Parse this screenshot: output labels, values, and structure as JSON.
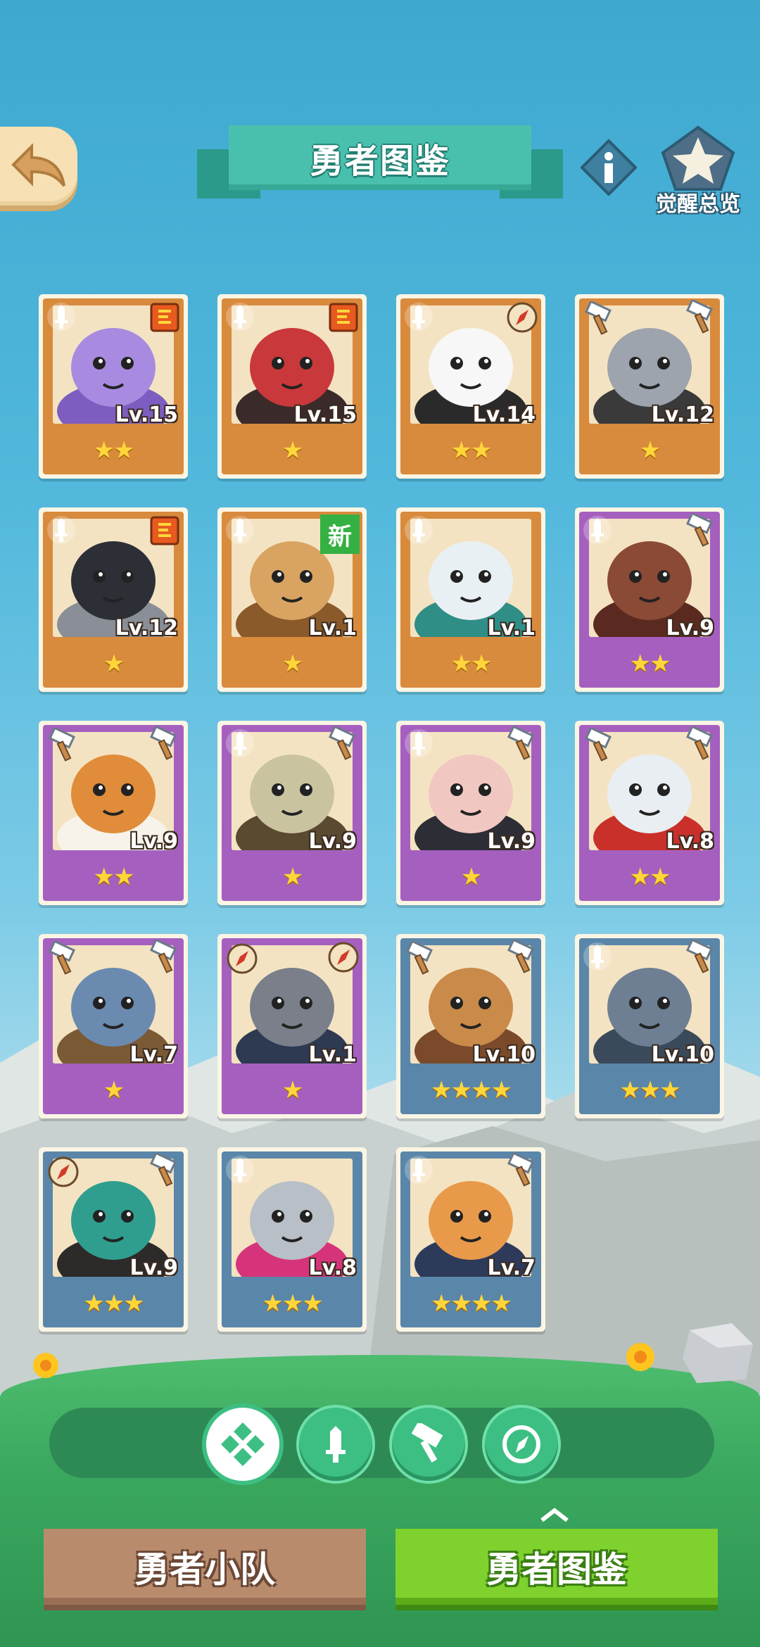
{
  "header": {
    "title": "勇者图鉴",
    "awaken_label": "觉醒总览"
  },
  "colors": {
    "orange_card": "#d88a3d",
    "purple_card": "#a560bf",
    "blue_card": "#5a86a9",
    "star": "#ffd63a",
    "new_badge": "#35b042"
  },
  "heroes": [
    {
      "level": "Lv.15",
      "stars": "★★",
      "rarity": "orange",
      "class_icon": "sword-icon",
      "weapon_icon": "scroll-icon",
      "portrait": "purple-elephant"
    },
    {
      "level": "Lv.15",
      "stars": "★",
      "rarity": "orange",
      "class_icon": "sword-icon",
      "weapon_icon": "scroll-icon",
      "portrait": "red-bird"
    },
    {
      "level": "Lv.14",
      "stars": "★★",
      "rarity": "orange",
      "class_icon": "sword-icon",
      "weapon_icon": "compass-icon",
      "portrait": "white-seal"
    },
    {
      "level": "Lv.12",
      "stars": "★",
      "rarity": "orange",
      "class_icon": "hammer-icon",
      "weapon_icon": "hammer-icon",
      "portrait": "gray-gorilla"
    },
    {
      "level": "Lv.12",
      "stars": "★",
      "rarity": "orange",
      "class_icon": "sword-icon",
      "weapon_icon": "scroll-icon",
      "portrait": "black-goat"
    },
    {
      "level": "Lv.1",
      "stars": "★",
      "rarity": "orange",
      "class_icon": "sword-icon",
      "badge": "新",
      "portrait": "lynx"
    },
    {
      "level": "Lv.1",
      "stars": "★★",
      "rarity": "orange",
      "class_icon": "sword-icon",
      "weapon_icon": "",
      "portrait": "polar-bear"
    },
    {
      "level": "Lv.9",
      "stars": "★★",
      "rarity": "purple",
      "class_icon": "sword-icon",
      "weapon_icon": "hammer-icon",
      "portrait": "brown-lizard"
    },
    {
      "level": "Lv.9",
      "stars": "★★",
      "rarity": "purple",
      "class_icon": "hammer-icon",
      "weapon_icon": "hammer-icon",
      "portrait": "pangolin"
    },
    {
      "level": "Lv.9",
      "stars": "★",
      "rarity": "purple",
      "class_icon": "sword-icon",
      "weapon_icon": "hammer-icon",
      "portrait": "deer"
    },
    {
      "level": "Lv.9",
      "stars": "★",
      "rarity": "purple",
      "class_icon": "sword-icon",
      "weapon_icon": "hammer-icon",
      "portrait": "ram"
    },
    {
      "level": "Lv.8",
      "stars": "★★",
      "rarity": "purple",
      "class_icon": "hammer-icon",
      "weapon_icon": "hammer-icon",
      "portrait": "white-wolf"
    },
    {
      "level": "Lv.7",
      "stars": "★",
      "rarity": "purple",
      "class_icon": "hammer-icon",
      "weapon_icon": "hammer-icon",
      "portrait": "boar"
    },
    {
      "level": "Lv.1",
      "stars": "★",
      "rarity": "purple",
      "class_icon": "compass-icon",
      "weapon_icon": "compass-icon",
      "portrait": "shark"
    },
    {
      "level": "Lv.10",
      "stars": "★★★★",
      "rarity": "blue",
      "class_icon": "hammer-icon",
      "weapon_icon": "hammer-icon",
      "portrait": "hooded-cat"
    },
    {
      "level": "Lv.10",
      "stars": "★★★",
      "rarity": "blue",
      "class_icon": "sword-icon",
      "weapon_icon": "hammer-icon",
      "portrait": "bat"
    },
    {
      "level": "Lv.9",
      "stars": "★★★",
      "rarity": "blue",
      "class_icon": "compass-icon",
      "weapon_icon": "hammer-icon",
      "portrait": "frog"
    },
    {
      "level": "Lv.8",
      "stars": "★★★",
      "rarity": "blue",
      "class_icon": "sword-icon",
      "weapon_icon": "",
      "portrait": "rhino"
    },
    {
      "level": "Lv.7",
      "stars": "★★★★",
      "rarity": "blue",
      "class_icon": "sword-icon",
      "weapon_icon": "hammer-icon",
      "portrait": "fox-police"
    }
  ],
  "filters": [
    {
      "name": "all-filter",
      "icon": "grid-icon",
      "active": true
    },
    {
      "name": "sword-filter",
      "icon": "sword-icon",
      "active": false
    },
    {
      "name": "hammer-filter",
      "icon": "hammer-icon",
      "active": false
    },
    {
      "name": "compass-filter",
      "icon": "compass-icon",
      "active": false
    }
  ],
  "tabs": {
    "team": "勇者小队",
    "codex": "勇者图鉴"
  }
}
